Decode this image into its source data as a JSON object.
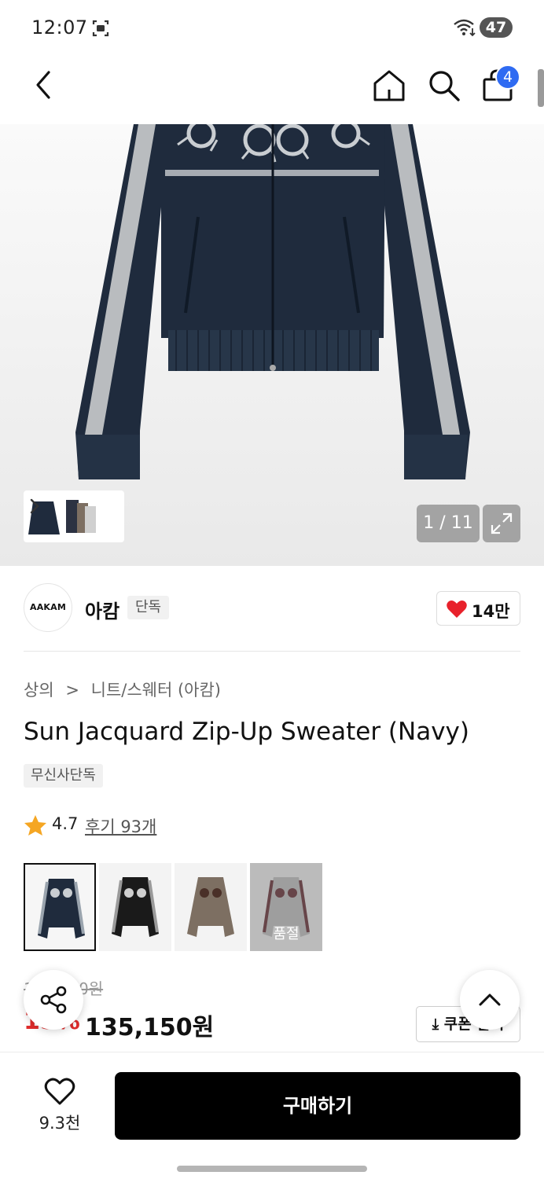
{
  "status_bar": {
    "time": "12:07",
    "battery": "47"
  },
  "nav": {
    "cart_badge": "4"
  },
  "gallery": {
    "page_counter": "1 / 11",
    "current_page": 1,
    "total_pages": 11
  },
  "brand": {
    "logo_text": "AAKAM",
    "name": "아캄",
    "tag": "단독",
    "like_count": "14만"
  },
  "breadcrumb": {
    "category": "상의",
    "separator": ">",
    "subcategory": "니트/스웨터 (아캄)"
  },
  "product": {
    "title": "Sun Jacquard Zip-Up Sweater (Navy)",
    "exclusive_tag": "무신사단독"
  },
  "rating": {
    "score": "4.7",
    "reviews": "후기 93개"
  },
  "variants": [
    {
      "name": "navy",
      "selected": true,
      "sold_out": false,
      "color": "#1f2b3d"
    },
    {
      "name": "black",
      "selected": false,
      "sold_out": false,
      "color": "#1a1a1a"
    },
    {
      "name": "brown",
      "selected": false,
      "sold_out": false,
      "color": "#7d6f62"
    },
    {
      "name": "grey",
      "selected": false,
      "sold_out": true,
      "color": "#a9a9a9",
      "label": "품절"
    }
  ],
  "price": {
    "original": "159,000원",
    "discount": "15%",
    "final": "135,150원",
    "coupon_label": "⤓ 쿠폰 받기"
  },
  "bottom_bar": {
    "wish_count": "9.3천",
    "buy_label": "구매하기"
  },
  "colors": {
    "accent_blue": "#2f6bf2",
    "discount_red": "#e02c2c",
    "heart_red": "#e8212b",
    "star": "#f5a623"
  }
}
